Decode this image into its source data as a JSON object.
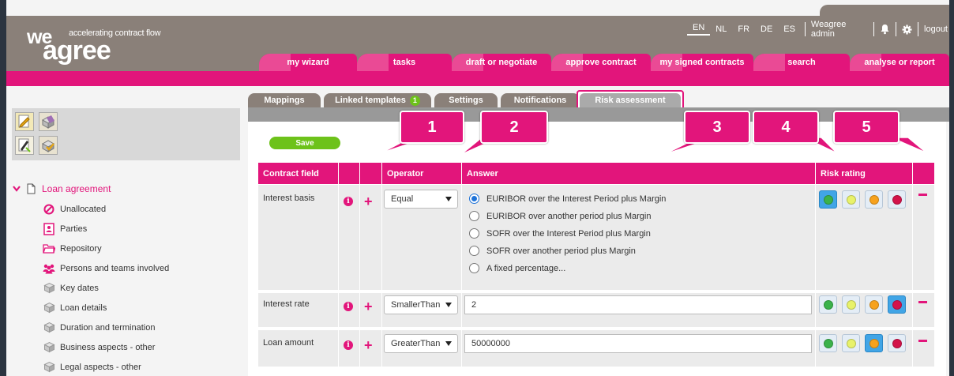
{
  "header": {
    "logo_we": "we",
    "logo_agree": "agree",
    "tagline": "accelerating contract flow",
    "languages": [
      "EN",
      "NL",
      "FR",
      "DE",
      "ES"
    ],
    "active_language": "EN",
    "user": "Weagree admin",
    "logout": "logout",
    "icons": [
      "bell-icon",
      "gear-icon"
    ]
  },
  "nav": {
    "tabs": [
      "my wizard",
      "tasks",
      "draft or negotiate",
      "approve contract",
      "my signed contracts",
      "search",
      "analyse or report"
    ]
  },
  "subtabs": {
    "items": [
      "Mappings",
      "Linked templates",
      "Settings",
      "Notifications",
      "Risk assessment"
    ],
    "badge": "1",
    "active": "Risk assessment"
  },
  "callouts": [
    "1",
    "2",
    "3",
    "4",
    "5"
  ],
  "save_label": "Save",
  "table": {
    "headers": [
      "Contract field",
      "",
      "",
      "Operator",
      "Answer",
      "Risk rating",
      ""
    ],
    "rows": [
      {
        "field": "Interest basis",
        "operator": "Equal",
        "answer_type": "radio",
        "options": [
          "EURIBOR over the Interest Period plus Margin",
          "EURIBOR over another period plus Margin",
          "SOFR over the Interest Period plus Margin",
          "SOFR over another period plus Margin",
          "A fixed percentage..."
        ],
        "selected_option": 0,
        "risk_selected": 0
      },
      {
        "field": "Interest rate",
        "operator": "SmallerThan",
        "answer_type": "text",
        "value": "2",
        "risk_selected": 3
      },
      {
        "field": "Loan amount",
        "operator": "GreaterThan",
        "answer_type": "text",
        "value": "50000000",
        "risk_selected": 2
      }
    ],
    "risk_colors": [
      "#3bb24a",
      "#e8f26a",
      "#f7a21d",
      "#d3134a"
    ]
  },
  "tree": {
    "root": "Loan agreement",
    "items": [
      {
        "label": "Unallocated",
        "icon": "no-entry-icon"
      },
      {
        "label": "Parties",
        "icon": "contact-card-icon"
      },
      {
        "label": "Repository",
        "icon": "folder-icon"
      },
      {
        "label": "Persons and teams involved",
        "icon": "people-icon"
      },
      {
        "label": "Key dates",
        "icon": "cube-icon"
      },
      {
        "label": "Loan details",
        "icon": "cube-icon"
      },
      {
        "label": "Duration and termination",
        "icon": "cube-icon"
      },
      {
        "label": "Business aspects - other",
        "icon": "cube-icon"
      },
      {
        "label": "Legal aspects - other",
        "icon": "cube-icon"
      }
    ]
  }
}
